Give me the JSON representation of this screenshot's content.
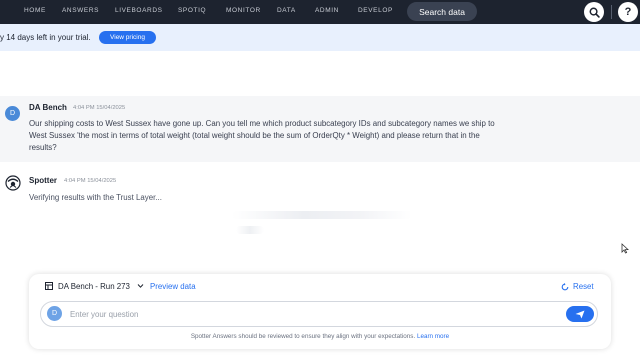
{
  "nav": {
    "items": [
      "HOME",
      "ANSWERS",
      "LIVEBOARDS",
      "SPOTIQ",
      "MONITOR",
      "DATA",
      "ADMIN",
      "DEVELOP"
    ],
    "search_button": "Search data",
    "help": "?"
  },
  "banner": {
    "text": "y 14 days left in your trial.",
    "cta": "View pricing"
  },
  "conversation": {
    "user_message": {
      "avatar": "D",
      "sender": "DA Bench",
      "time": "4:04 PM 15/04/2025",
      "text": "Our shipping costs to West Sussex have gone up. Can you tell me which product subcategory IDs and subcategory names we ship to West Sussex 'the most in terms of total weight (total weight should be the sum of OrderQty * Weight) and please return that in the results?"
    },
    "spotter_message": {
      "sender": "Spotter",
      "time": "4:04 PM 15/04/2025",
      "status": "Verifying results with the Trust Layer..."
    }
  },
  "panel": {
    "dataset": "DA Bench - Run 273",
    "preview": "Preview data",
    "reset": "Reset",
    "input_avatar": "D",
    "placeholder": "Enter your question",
    "disclaimer": "Spotter Answers should be reviewed to ensure they align with your expectations.",
    "learn_more": "Learn more"
  },
  "colors": {
    "nav_bg": "#1d232f",
    "accent": "#2770ef",
    "banner_bg": "#e8f0fd",
    "avatar": "#4a8ad8"
  },
  "icons": [
    "search-icon",
    "help-icon",
    "spotter-logo-icon",
    "table-icon",
    "chevron-down-icon",
    "reset-icon",
    "send-icon",
    "mouse-cursor-icon"
  ]
}
